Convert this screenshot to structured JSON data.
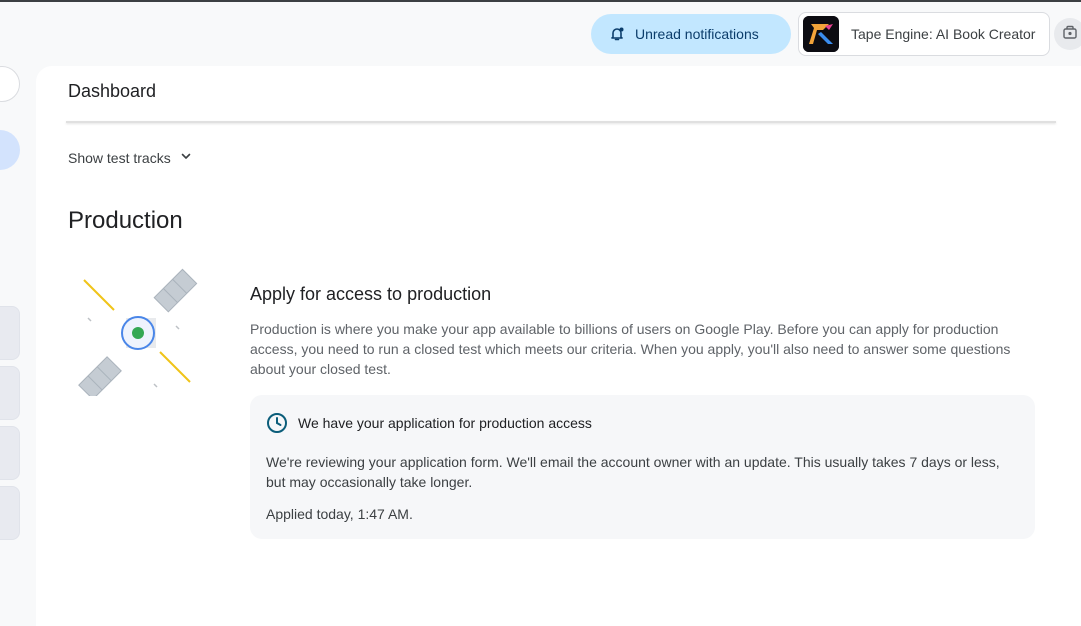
{
  "header": {
    "notifications_label": "Unread notifications",
    "app_name": "Tape Engine: AI Book Creator"
  },
  "page": {
    "title": "Dashboard",
    "test_tracks_toggle": "Show test tracks"
  },
  "production": {
    "section_title": "Production",
    "card_title": "Apply for access to production",
    "card_description": "Production is where you make your app available to billions of users on Google Play. Before you can apply for production access, you need to run a closed test which meets our criteria. When you apply, you'll also need to answer some questions about your closed test.",
    "notice": {
      "heading": "We have your application for production access",
      "body": "We're reviewing your application form. We'll email the account owner with an update. This usually takes 7 days or less, but may occasionally take longer.",
      "applied": "Applied today, 1:47 AM."
    }
  },
  "icons": {
    "notifications": "bell-ring-icon",
    "app": "app-logo-icon",
    "account": "account-icon",
    "dropdown": "chevron-down-icon",
    "status": "clock-icon",
    "illustration": "satellite-illustration"
  },
  "colors": {
    "accent": "#c2e7ff",
    "rail_active": "#d3e3fd",
    "notice_bg": "#f6f7f9",
    "status_icon": "#0b5d7a"
  }
}
